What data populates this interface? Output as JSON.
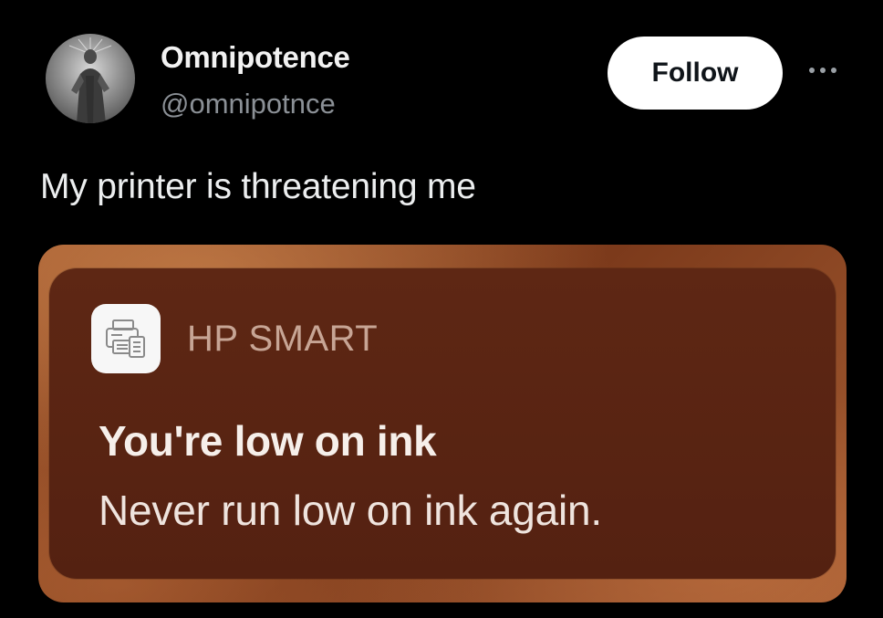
{
  "post": {
    "author": {
      "display_name": "Omnipotence",
      "handle": "@omnipotnce",
      "avatar_icon": "statue-avatar"
    },
    "follow_label": "Follow",
    "more_icon": "more-horizontal-icon",
    "text": "My printer is threatening me"
  },
  "notification": {
    "app_icon": "printer-icon",
    "app_name": "HP SMART",
    "title": "You're low on ink",
    "body": "Never run low on ink again."
  },
  "colors": {
    "background": "#000000",
    "follow_button_bg": "#ffffff",
    "notification_bg": "#5a2412",
    "notification_frame": "#9a532b"
  }
}
